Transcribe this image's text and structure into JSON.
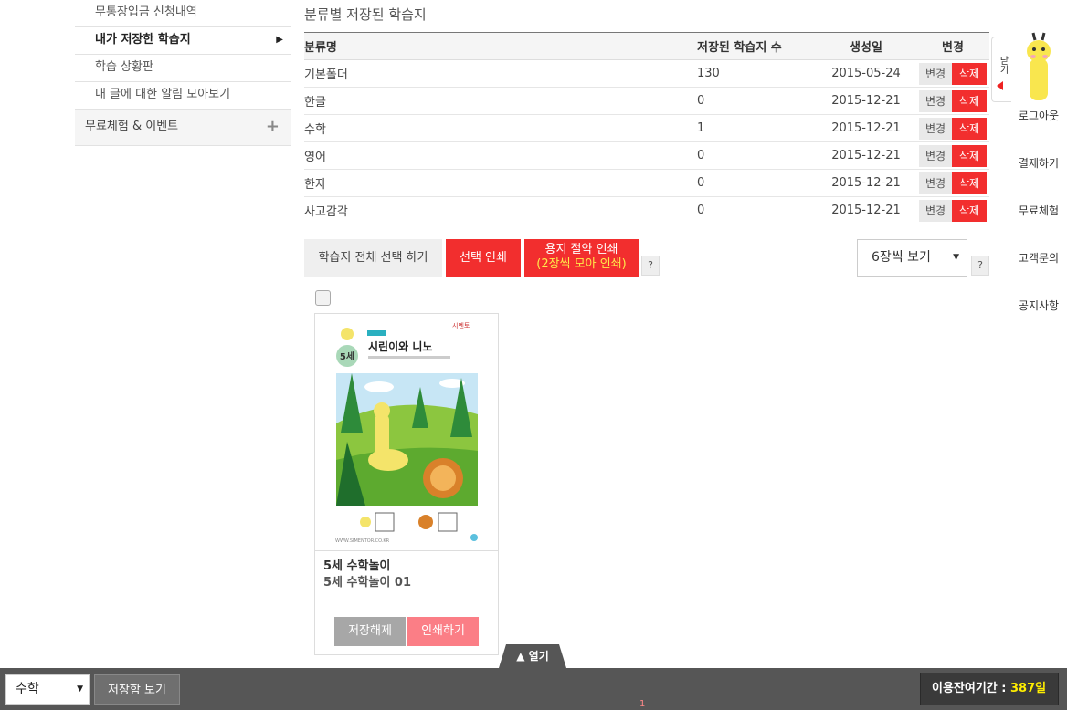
{
  "sidebar": {
    "subitems": [
      "무통장입금 신청내역",
      "내가 저장한 학습지",
      "학습 상황판",
      "내 글에 대한 알림 모아보기"
    ],
    "active_arrow": "▶",
    "main_item": "무료체험 & 이벤트",
    "plus_icon": "+"
  },
  "main": {
    "title": "분류별 저장된 학습지",
    "table": {
      "headers": [
        "분류명",
        "저장된 학습지 수",
        "생성일",
        "변경"
      ],
      "rows": [
        {
          "name": "기본폴더",
          "count": "130",
          "date": "2015-05-24"
        },
        {
          "name": "한글",
          "count": "0",
          "date": "2015-12-21"
        },
        {
          "name": "수학",
          "count": "1",
          "date": "2015-12-21"
        },
        {
          "name": "영어",
          "count": "0",
          "date": "2015-12-21"
        },
        {
          "name": "한자",
          "count": "0",
          "date": "2015-12-21"
        },
        {
          "name": "사고감각",
          "count": "0",
          "date": "2015-12-21"
        }
      ],
      "edit_label": "변경",
      "delete_label": "삭제"
    },
    "toolbar": {
      "select_all": "학습지 전체 선택 하기",
      "print_selected": "선택 인쇄",
      "save_paper_line1": "용지 절약 인쇄",
      "save_paper_line2": "(2장씩 모아 인쇄)",
      "help": "?",
      "view_select": "6장씩 보기"
    },
    "card": {
      "badge": "5세",
      "sheet_title": "시린이와 니노",
      "sheet_brand": "시멘토",
      "sheet_url": "WWW.SIMENTOR.CO.KR",
      "title": "5세 수학놀이",
      "subtitle": "5세 수학놀이 01",
      "unsave_label": "저장해제",
      "print_label": "인쇄하기"
    }
  },
  "right_strip": {
    "tab_label": "닫기",
    "links": [
      "로그아웃",
      "결제하기",
      "무료체험",
      "고객문의",
      "공지사항"
    ]
  },
  "bottom": {
    "open_label": "▲ 열기",
    "category_select": "수학",
    "saved_view": "저장함 보기",
    "page_num": "1",
    "period_label": "이용잔여기간 : ",
    "period_value": "387일"
  },
  "colors": {
    "red": "#f22e2e",
    "pink": "#fb7e86",
    "yellow": "#ffea4a",
    "bar": "#565656"
  }
}
